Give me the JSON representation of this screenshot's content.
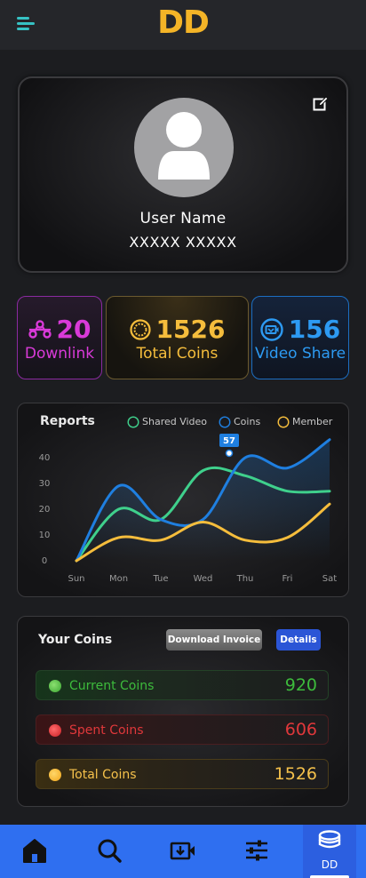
{
  "app": {
    "logo_text": "DD"
  },
  "profile": {
    "user_name": "User Name",
    "user_id": "XXXXX XXXXX"
  },
  "stats": [
    {
      "value": "20",
      "label": "Downlink",
      "icon": "network-icon",
      "color": "#d93ad8"
    },
    {
      "value": "1526",
      "label": "Total Coins",
      "icon": "coin-icon",
      "color": "#f5bd3c"
    },
    {
      "value": "156",
      "label": "Video Share",
      "icon": "video-share-icon",
      "color": "#2d9af2"
    }
  ],
  "reports": {
    "title": "Reports",
    "legend": [
      "Shared Video",
      "Coins",
      "Member"
    ],
    "tooltip": "57"
  },
  "chart_data": {
    "type": "line",
    "categories": [
      "Sun",
      "Mon",
      "Tue",
      "Wed",
      "Thu",
      "Fri",
      "Sat"
    ],
    "yticks": [
      0,
      10,
      20,
      30,
      40
    ],
    "ylim": [
      0,
      50
    ],
    "series": [
      {
        "name": "Shared Video",
        "color": "#3fd08c",
        "values": [
          0,
          20,
          16,
          35,
          33,
          27,
          27
        ]
      },
      {
        "name": "Coins",
        "color": "#1f7fe0",
        "values": [
          0,
          29,
          16,
          16,
          40,
          36,
          47
        ]
      },
      {
        "name": "Member",
        "color": "#f5bd3c",
        "values": [
          0,
          9,
          8,
          15,
          8,
          9,
          22
        ]
      }
    ],
    "legend_position": "top-right",
    "grid": false
  },
  "coins": {
    "title": "Your Coins",
    "download_label": "Download Invoice",
    "details_label": "Details",
    "rows": [
      {
        "label": "Current Coins",
        "value": "920"
      },
      {
        "label": "Spent Coins",
        "value": "606"
      },
      {
        "label": "Total Coins",
        "value": "1526"
      }
    ]
  },
  "nav": {
    "active_label": "DD",
    "items": [
      "home-icon",
      "search-icon",
      "video-upload-icon",
      "filter-sliders-icon",
      "coins-stack-icon"
    ]
  }
}
